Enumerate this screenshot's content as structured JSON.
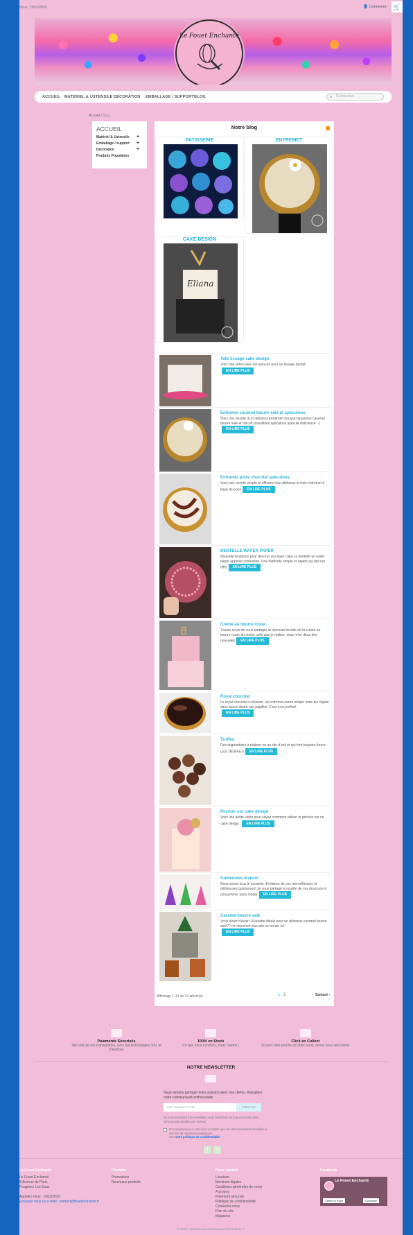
{
  "topbar": {
    "phone": "Nous : 0563/2020",
    "login": "Connexion"
  },
  "logo": {
    "text": "Le Fouet Enchanté"
  },
  "nav": {
    "items": [
      "ACCUEIL",
      "MATÉRIEL & USTENSILE",
      "DÉCORATION",
      "EMBALLAGE / SUPPORT",
      "BLOG"
    ],
    "search_placeholder": "Rechercher"
  },
  "breadcrumb": {
    "home": "Accueil",
    "sep": "/",
    "current": "Blog"
  },
  "sidebar": {
    "title": "ACCUEIL",
    "items": [
      "Matériel & Ustensile",
      "Emballage / support",
      "Décoration",
      "Produits Populaires"
    ]
  },
  "blog": {
    "title": "Notre blog",
    "categories": [
      "PATISSERIE",
      "ENTREMET",
      "CAKE DESIGN"
    ],
    "read_more": "EN LIRE PLUS",
    "posts": [
      {
        "title": "Tuto lissage cake design",
        "excerpt": "Voici une vidéo avec les astuces pour un lissage parfait!"
      },
      {
        "title": "Entremet caramel beurre salé et spéculoos",
        "excerpt": "Voici une recette d'un délicieux entremet mousse bavaroise caramel beurre salé et biscuit croustillant spéculoos spéculé délicieuse :-)"
      },
      {
        "title": "Entremet poire chocolat spéculoos",
        "excerpt": "Voici une recette simple et efficace d'un délicieux et frais entremet à base de poire"
      },
      {
        "title": "DENTELLE WAFER PAPER",
        "excerpt": "Nouvelle tendance pour décorer vos layer cake, la dentelle en wafer paper appelée comestine. Une méthode simple et rapide qui fait son effet"
      },
      {
        "title": "Crème au beurre russe",
        "excerpt": "J'avais envie de vous partager la fameuse recette de la crème au beurre russe du moins celle que je réalise, vous m'en direz des nouvelles"
      },
      {
        "title": "Royal chocolat",
        "excerpt": "Le royal chocolat ou trianon, un entremet assez simple mais qui régale sans aucun doute nos papilles! C'est mon préféré"
      },
      {
        "title": "Truffes",
        "excerpt": "Des mignardises à réaliser en un clin d'oeil et qui font toujours fureur : LES TRUFFES"
      },
      {
        "title": "Pochoir sur cake design",
        "excerpt": "Voici une petite vidéo pour savoir comment utiliser le pochoir sur un cake design :"
      },
      {
        "title": "Guimauves maison",
        "excerpt": "Nous avons tous le souvenir d'enfance de ces merveilleuses et délicieuses guimauves! Je vous partage la recette de ces douceurs à consommer sans modér"
      },
      {
        "title": "Caramel beurre salé",
        "excerpt": "Vous rêvez d'avoir LA recette idéale pour un délicieux caramel beurre salé?? ne cherchez plus elle se trouve ici!!"
      }
    ],
    "pager": {
      "count": "Affichage 1-10 de 14 article(s)",
      "page1": "1",
      "page2": "2",
      "next": "Suivant ›"
    }
  },
  "reassurance": [
    {
      "title": "Paiements Sécurisés",
      "text": "Sécurité de vos transactions, avec les technologies SSL et Checkout."
    },
    {
      "title": "100% en Stock",
      "text": "Ce que nous vendons, nous l'avons !"
    },
    {
      "title": "Click en Collect",
      "text": "Si vous êtes proche de chez nous, venez nous rencontrer"
    }
  ],
  "newsletter": {
    "title": "NOTRE NEWSLETTER",
    "text": "Nous aimons partager notre passion avec nos clients. Rejoignez notre communauté enthousiaste.",
    "placeholder": "Votre adresse e-mail",
    "button": "S'abonner",
    "note": "En vous inscrivant à la newsletter, vous bénéficiez de tous nos bons plans, sans aucune pénible une mésse!",
    "consent": "En marquant par ce site vous acceptez que vos données soient recueillies à des fins de traitement analytiques",
    "policy_prefix": "Voir ",
    "policy_link": "notre politique de confidentialité"
  },
  "footer": {
    "col1": {
      "title": "Le Fouet Enchanté",
      "lines": [
        "Le Fouet Enchanté",
        "8 Avenue de Paris",
        "Fougères Les Eaux",
        "",
        "Appelez-nous : 0563/2020",
        "Envoyez-nous un e-mail : contact@fouetenchante.fr"
      ]
    },
    "col2": {
      "title": "Produits",
      "lines": [
        "Promotions",
        "Nouveaux produits"
      ]
    },
    "col3": {
      "title": "Notre société",
      "lines": [
        "Livraison",
        "Mentions légales",
        "Conditions générales de vente",
        "A propos",
        "Paiement sécurisé",
        "Politique de confidentialité",
        "Contactez-nous",
        "Plan du site",
        "Magasins"
      ]
    },
    "col4": {
      "title": "Facebook",
      "fb_title": "Le Fouet Enchanté",
      "fb_btn1": "J'aime la Page",
      "fb_btn2": "Contacter"
    },
    "copy": "© 2020 - Ecommerce software par PrestaShop™"
  }
}
